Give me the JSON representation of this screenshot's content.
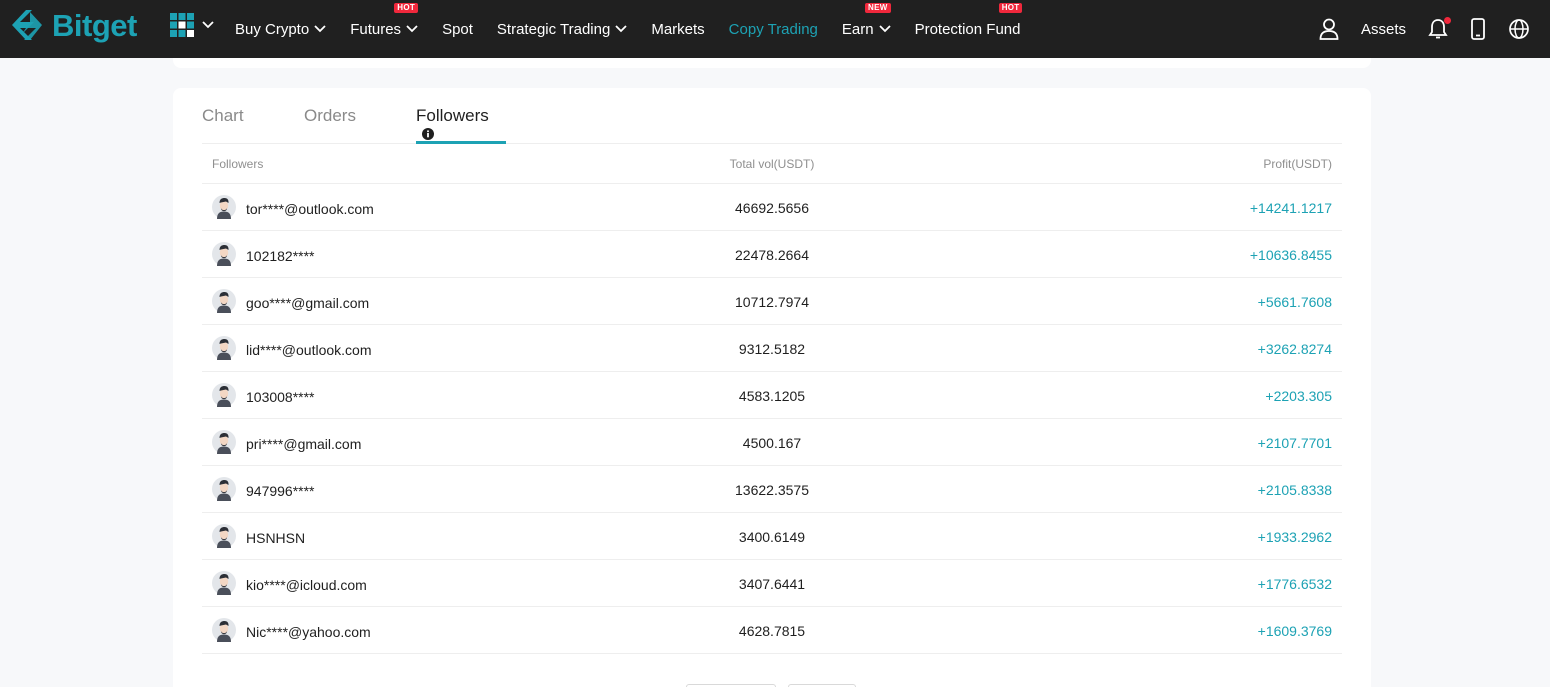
{
  "brand": {
    "name": "Bitget"
  },
  "nav": {
    "items": [
      {
        "label": "Buy Crypto",
        "chevron": true,
        "badge": ""
      },
      {
        "label": "Futures",
        "chevron": true,
        "badge": "HOT"
      },
      {
        "label": "Spot",
        "chevron": false,
        "badge": ""
      },
      {
        "label": "Strategic Trading",
        "chevron": true,
        "badge": ""
      },
      {
        "label": "Markets",
        "chevron": false,
        "badge": ""
      },
      {
        "label": "Copy Trading",
        "chevron": false,
        "badge": "",
        "active": true
      },
      {
        "label": "Earn",
        "chevron": true,
        "badge": "NEW"
      },
      {
        "label": "Protection Fund",
        "chevron": false,
        "badge": "HOT"
      }
    ],
    "assets_label": "Assets"
  },
  "tabs": [
    {
      "label": "Chart"
    },
    {
      "label": "Orders"
    },
    {
      "label": "Followers",
      "active": true
    }
  ],
  "table": {
    "headers": {
      "followers": "Followers",
      "total_vol": "Total vol(USDT)",
      "profit": "Profit(USDT)"
    },
    "rows": [
      {
        "name": "tor****@outlook.com",
        "vol": "46692.5656",
        "profit": "+14241.1217"
      },
      {
        "name": "102182****",
        "vol": "22478.2664",
        "profit": "+10636.8455"
      },
      {
        "name": "goo****@gmail.com",
        "vol": "10712.7974",
        "profit": "+5661.7608"
      },
      {
        "name": "lid****@outlook.com",
        "vol": "9312.5182",
        "profit": "+3262.8274"
      },
      {
        "name": "103008****",
        "vol": "4583.1205",
        "profit": "+2203.305"
      },
      {
        "name": "pri****@gmail.com",
        "vol": "4500.167",
        "profit": "+2107.7701"
      },
      {
        "name": "947996****",
        "vol": "13622.3575",
        "profit": "+2105.8338"
      },
      {
        "name": "HSNHSN",
        "vol": "3400.6149",
        "profit": "+1933.2962"
      },
      {
        "name": "kio****@icloud.com",
        "vol": "3407.6441",
        "profit": "+1776.6532"
      },
      {
        "name": "Nic****@yahoo.com",
        "vol": "4628.7815",
        "profit": "+1609.3769"
      }
    ]
  },
  "colors": {
    "accent": "#1da2b4",
    "badge": "#f0283c",
    "nav_bg": "#202020"
  }
}
